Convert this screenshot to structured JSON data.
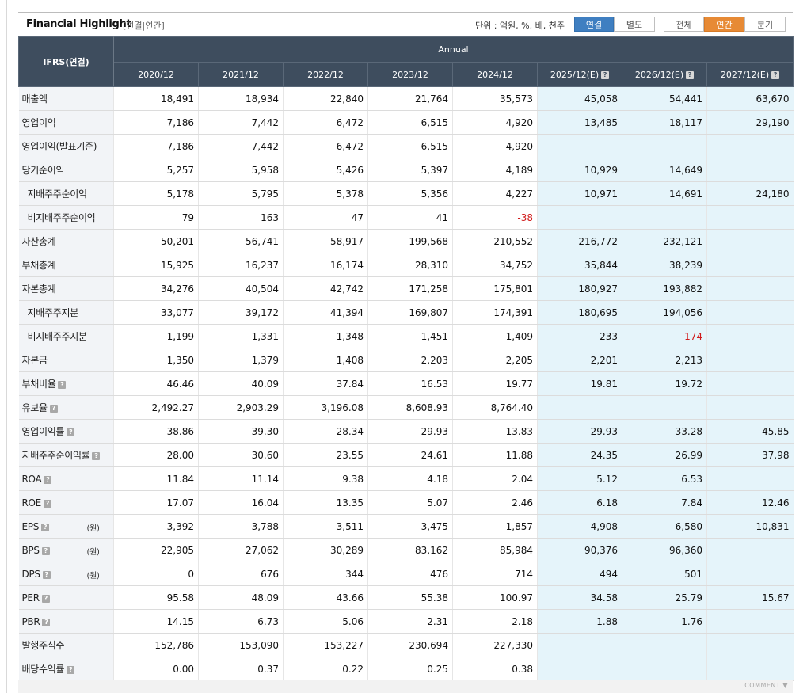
{
  "header": {
    "title": "Financial Highlight",
    "subtitle": "[연결|연간]",
    "unit_label": "단위 : 억원, %, 배, 천주",
    "buttons": [
      "연결",
      "별도",
      "전체",
      "연간",
      "분기"
    ]
  },
  "table": {
    "corner": "IFRS(연결)",
    "group": "Annual",
    "columns": [
      "2020/12",
      "2021/12",
      "2022/12",
      "2023/12",
      "2024/12",
      "2025/12(E)",
      "2026/12(E)",
      "2027/12(E)"
    ],
    "help_icon": "?",
    "won_unit": "(원)",
    "rows": [
      {
        "label": "매출액",
        "values": [
          "18,491",
          "18,934",
          "22,840",
          "21,764",
          "35,573",
          "45,058",
          "54,441",
          "63,670"
        ]
      },
      {
        "label": "영업이익",
        "values": [
          "7,186",
          "7,442",
          "6,472",
          "6,515",
          "4,920",
          "13,485",
          "18,117",
          "29,190"
        ]
      },
      {
        "label": "영업이익(발표기준)",
        "values": [
          "7,186",
          "7,442",
          "6,472",
          "6,515",
          "4,920",
          "",
          "",
          ""
        ]
      },
      {
        "label": "당기순이익",
        "values": [
          "5,257",
          "5,958",
          "5,426",
          "5,397",
          "4,189",
          "10,929",
          "14,649",
          ""
        ]
      },
      {
        "label": "지배주주순이익",
        "values": [
          "5,178",
          "5,795",
          "5,378",
          "5,356",
          "4,227",
          "10,971",
          "14,691",
          "24,180"
        ]
      },
      {
        "label": "비지배주주순이익",
        "values": [
          "79",
          "163",
          "47",
          "41",
          "-38",
          "",
          "",
          ""
        ]
      },
      {
        "label": "자산총계",
        "values": [
          "50,201",
          "56,741",
          "58,917",
          "199,568",
          "210,552",
          "216,772",
          "232,121",
          ""
        ]
      },
      {
        "label": "부채총계",
        "values": [
          "15,925",
          "16,237",
          "16,174",
          "28,310",
          "34,752",
          "35,844",
          "38,239",
          ""
        ]
      },
      {
        "label": "자본총계",
        "values": [
          "34,276",
          "40,504",
          "42,742",
          "171,258",
          "175,801",
          "180,927",
          "193,882",
          ""
        ]
      },
      {
        "label": "지배주주지분",
        "values": [
          "33,077",
          "39,172",
          "41,394",
          "169,807",
          "174,391",
          "180,695",
          "194,056",
          ""
        ]
      },
      {
        "label": "비지배주주지분",
        "values": [
          "1,199",
          "1,331",
          "1,348",
          "1,451",
          "1,409",
          "233",
          "-174",
          ""
        ]
      },
      {
        "label": "자본금",
        "values": [
          "1,350",
          "1,379",
          "1,408",
          "2,203",
          "2,205",
          "2,201",
          "2,213",
          ""
        ]
      },
      {
        "label": "부채비율",
        "values": [
          "46.46",
          "40.09",
          "37.84",
          "16.53",
          "19.77",
          "19.81",
          "19.72",
          ""
        ]
      },
      {
        "label": "유보율",
        "values": [
          "2,492.27",
          "2,903.29",
          "3,196.08",
          "8,608.93",
          "8,764.40",
          "",
          "",
          ""
        ]
      },
      {
        "label": "영업이익률",
        "values": [
          "38.86",
          "39.30",
          "28.34",
          "29.93",
          "13.83",
          "29.93",
          "33.28",
          "45.85"
        ]
      },
      {
        "label": "지배주주순이익률",
        "values": [
          "28.00",
          "30.60",
          "23.55",
          "24.61",
          "11.88",
          "24.35",
          "26.99",
          "37.98"
        ]
      },
      {
        "label": "ROA",
        "values": [
          "11.84",
          "11.14",
          "9.38",
          "4.18",
          "2.04",
          "5.12",
          "6.53",
          ""
        ]
      },
      {
        "label": "ROE",
        "values": [
          "17.07",
          "16.04",
          "13.35",
          "5.07",
          "2.46",
          "6.18",
          "7.84",
          "12.46"
        ]
      },
      {
        "label": "EPS",
        "values": [
          "3,392",
          "3,788",
          "3,511",
          "3,475",
          "1,857",
          "4,908",
          "6,580",
          "10,831"
        ]
      },
      {
        "label": "BPS",
        "values": [
          "22,905",
          "27,062",
          "30,289",
          "83,162",
          "85,984",
          "90,376",
          "96,360",
          ""
        ]
      },
      {
        "label": "DPS",
        "values": [
          "0",
          "676",
          "344",
          "476",
          "714",
          "494",
          "501",
          ""
        ]
      },
      {
        "label": "PER",
        "values": [
          "95.58",
          "48.09",
          "43.66",
          "55.38",
          "100.97",
          "34.58",
          "25.79",
          "15.67"
        ]
      },
      {
        "label": "PBR",
        "values": [
          "14.15",
          "6.73",
          "5.06",
          "2.31",
          "2.18",
          "1.88",
          "1.76",
          ""
        ]
      },
      {
        "label": "발행주식수",
        "values": [
          "152,786",
          "153,090",
          "153,227",
          "230,694",
          "227,330",
          "",
          "",
          ""
        ]
      },
      {
        "label": "배당수익률",
        "values": [
          "0.00",
          "0.37",
          "0.22",
          "0.25",
          "0.38",
          "",
          "",
          ""
        ]
      }
    ]
  },
  "footer": {
    "comment": "COMMENT ▼"
  }
}
